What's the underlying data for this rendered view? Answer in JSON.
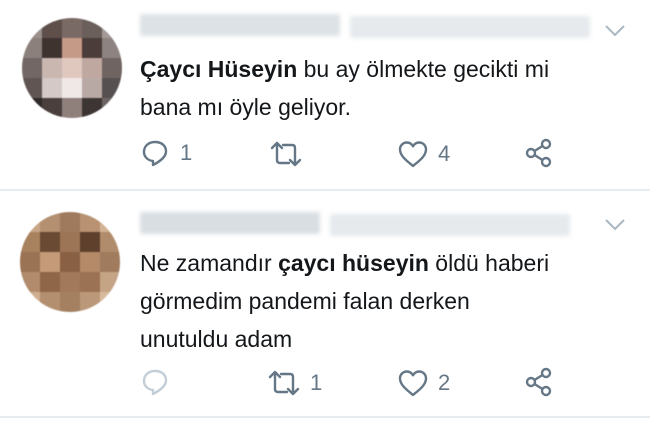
{
  "tweets": [
    {
      "mention": "Çaycı Hüseyin",
      "text_after": " bu ay ölmekte gecikti mi",
      "text_line2": "bana mı öyle geliyor.",
      "replies": "1",
      "retweets": "",
      "likes": "4"
    },
    {
      "text_before": "Ne zamandır ",
      "mention": "çaycı hüseyin",
      "text_after": " öldü haberi",
      "text_line2": "görmedim pandemi falan derken",
      "text_line3": "unutuldu adam",
      "replies": "",
      "retweets": "1",
      "likes": "2"
    }
  ],
  "icons": {
    "reply": "reply-icon",
    "retweet": "retweet-icon",
    "like": "heart-icon",
    "share": "share-icon",
    "menu": "chevron-down-icon"
  },
  "colors": {
    "icon": "#657786",
    "text": "#14171a",
    "divider": "#e6ecf0"
  }
}
